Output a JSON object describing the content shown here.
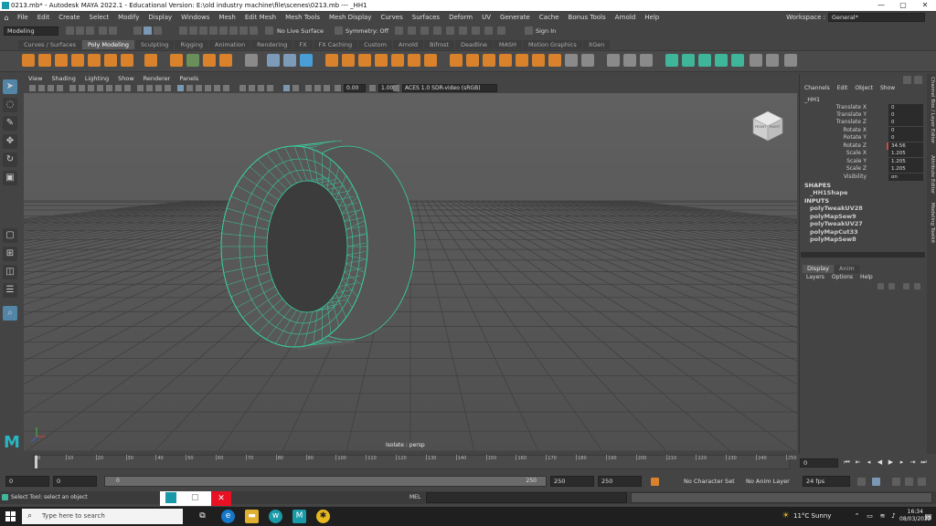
{
  "window": {
    "title": "0213.mb* - Autodesk MAYA 2022.1 - Educational Version: E:\\old industry machine\\file\\scenes\\0213.mb   ---   _HH1",
    "controls": [
      "—",
      "▢",
      "✕"
    ]
  },
  "menubar": {
    "items": [
      "File",
      "Edit",
      "Create",
      "Select",
      "Modify",
      "Display",
      "Windows",
      "Mesh",
      "Edit Mesh",
      "Mesh Tools",
      "Mesh Display",
      "Curves",
      "Surfaces",
      "Deform",
      "UV",
      "Generate",
      "Cache",
      "Bonus Tools",
      "Arnold",
      "Help"
    ],
    "workspace_label": "Workspace :",
    "workspace_value": "General*"
  },
  "statusline": {
    "menuset": "Modeling",
    "live_surface": "No Live Surface",
    "symmetry": "Symmetry: Off",
    "signin": "Sign In"
  },
  "shelf": {
    "tabs": [
      "Curves / Surfaces",
      "Poly Modeling",
      "Sculpting",
      "Rigging",
      "Animation",
      "Rendering",
      "FX",
      "FX Caching",
      "Custom",
      "Arnold",
      "Bifrost",
      "Deadline",
      "MASH",
      "Motion Graphics",
      "XGen"
    ],
    "active_tab": "Poly Modeling"
  },
  "viewport": {
    "menu": [
      "View",
      "Shading",
      "Lighting",
      "Show",
      "Renderer",
      "Panels"
    ],
    "exposure": "0.00",
    "gamma": "1.00",
    "color_space": "ACES 1.0 SDR-video (sRGB)",
    "camera_label": "Isolate : persp",
    "viewcube_front": "FRONT",
    "viewcube_right": "RIGHT",
    "wire_color": "#35d6a4"
  },
  "channelbox": {
    "menu": [
      "Channels",
      "Edit",
      "Object",
      "Show"
    ],
    "object": "_HH1",
    "channels": [
      {
        "label": "Translate X",
        "value": "0"
      },
      {
        "label": "Translate Y",
        "value": "0"
      },
      {
        "label": "Translate Z",
        "value": "0"
      },
      {
        "label": "Rotate X",
        "value": "0"
      },
      {
        "label": "Rotate Y",
        "value": "0"
      },
      {
        "label": "Rotate Z",
        "value": "34.56"
      },
      {
        "label": "Scale X",
        "value": "1.205"
      },
      {
        "label": "Scale Y",
        "value": "1.205"
      },
      {
        "label": "Scale Z",
        "value": "1.205"
      },
      {
        "label": "Visibility",
        "value": "on"
      }
    ],
    "shapes_header": "SHAPES",
    "shape": "_HH1Shape",
    "inputs_header": "INPUTS",
    "inputs": [
      "polyTweakUV28",
      "polyMapSew9",
      "polyTweakUV27",
      "polyMapCut33",
      "polyMapSew8"
    ]
  },
  "layers": {
    "tabs": [
      "Display",
      "Anim"
    ],
    "menu": [
      "Layers",
      "Options",
      "Help"
    ]
  },
  "sidetabs": [
    "Channel Box / Layer Editor",
    "Attribute Editor",
    "Modeling Toolkit"
  ],
  "timeline": {
    "ticks": [
      "0",
      "10",
      "20",
      "30",
      "40",
      "50",
      "60",
      "70",
      "80",
      "90",
      "100",
      "110",
      "120",
      "130",
      "140",
      "150",
      "160",
      "170",
      "180",
      "190",
      "200",
      "210",
      "220",
      "230",
      "240",
      "250"
    ],
    "current_frame": "0",
    "field_value": "0"
  },
  "range": {
    "start": "0",
    "anim_start": "0",
    "range_lo": "0",
    "range_hi": "250",
    "end": "250",
    "anim_end": "250",
    "character_set": "No Character Set",
    "anim_layer": "No Anim Layer",
    "fps": "24 fps"
  },
  "commandline": {
    "help": "Select Tool: select an object",
    "mel": "MEL"
  },
  "taskbar": {
    "search_placeholder": "Type here to search",
    "weather": "11°C  Sunny",
    "time": "16:34",
    "date": "08/03/2022"
  }
}
